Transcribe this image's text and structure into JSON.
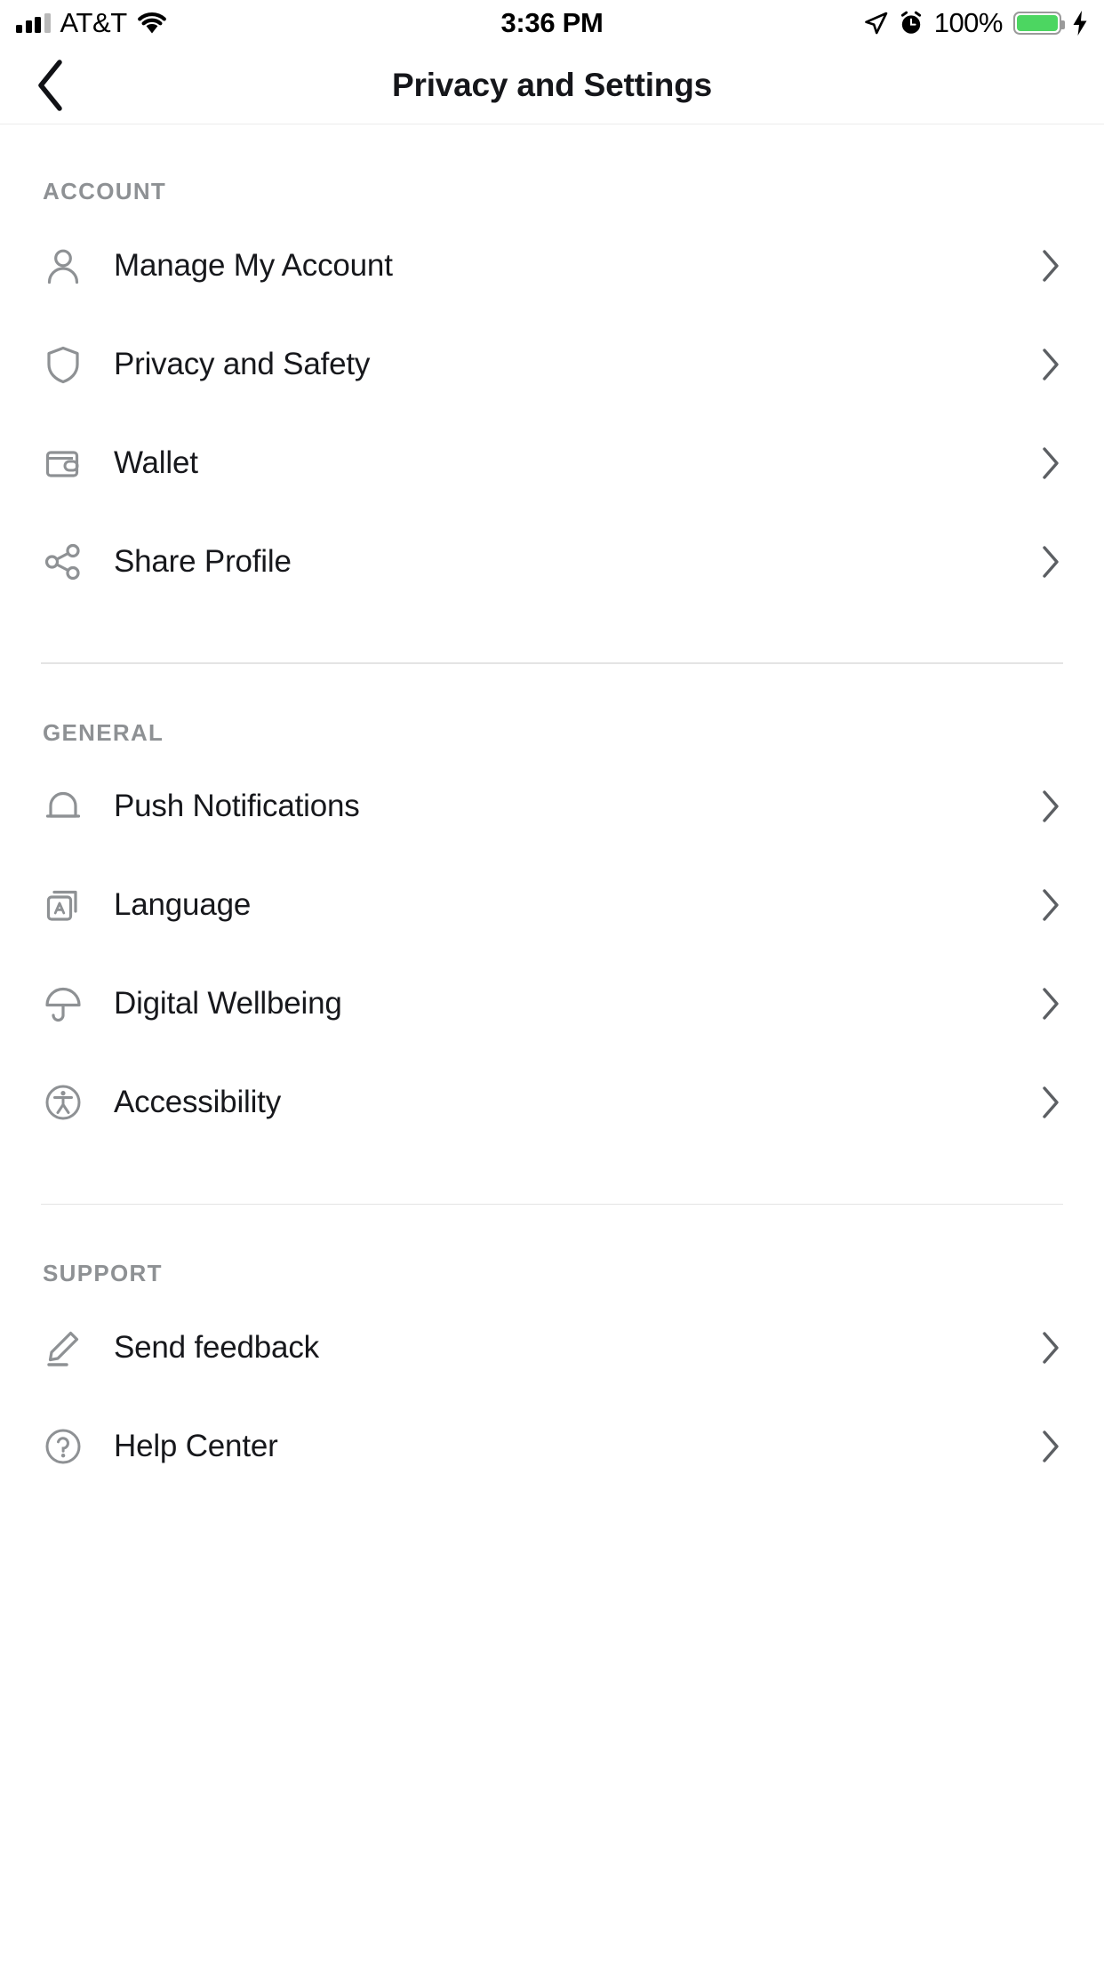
{
  "status_bar": {
    "carrier": "AT&T",
    "time": "3:36 PM",
    "battery_percent": "100%",
    "icons": {
      "signal": "signal-bars-icon",
      "wifi": "wifi-icon",
      "location": "location-arrow-icon",
      "alarm": "alarm-clock-icon",
      "battery": "battery-icon",
      "charging": "lightning-bolt-icon"
    },
    "battery_color": "#4cd661"
  },
  "navbar": {
    "title": "Privacy and Settings",
    "back_icon": "chevron-left-icon"
  },
  "sections": [
    {
      "header": "ACCOUNT",
      "items": [
        {
          "label": "Manage My Account",
          "icon": "person-icon"
        },
        {
          "label": "Privacy and Safety",
          "icon": "shield-icon"
        },
        {
          "label": "Wallet",
          "icon": "wallet-icon"
        },
        {
          "label": "Share Profile",
          "icon": "share-icon"
        }
      ]
    },
    {
      "header": "GENERAL",
      "items": [
        {
          "label": "Push Notifications",
          "icon": "bell-icon"
        },
        {
          "label": "Language",
          "icon": "language-icon"
        },
        {
          "label": "Digital Wellbeing",
          "icon": "umbrella-icon"
        },
        {
          "label": "Accessibility",
          "icon": "accessibility-icon"
        }
      ]
    },
    {
      "header": "SUPPORT",
      "items": [
        {
          "label": "Send feedback",
          "icon": "pencil-icon"
        },
        {
          "label": "Help Center",
          "icon": "question-circle-icon"
        }
      ]
    }
  ],
  "colors": {
    "icon_gray": "#8e9194",
    "label_text": "#17181c",
    "section_text": "#8e9194",
    "divider": "#e4e4e4",
    "chevron": "#5c5f63"
  }
}
